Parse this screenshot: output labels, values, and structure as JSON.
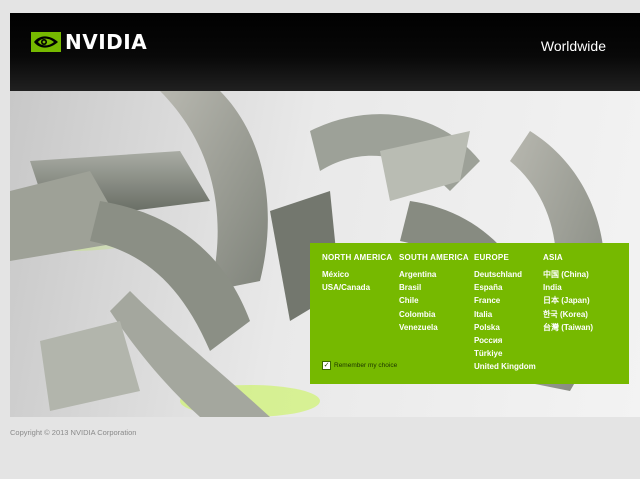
{
  "header": {
    "brand": "NVIDIA",
    "region_title": "Worldwide"
  },
  "regions": [
    {
      "heading": "NORTH AMERICA",
      "links": [
        "México",
        "USA/Canada"
      ]
    },
    {
      "heading": "SOUTH AMERICA",
      "links": [
        "Argentina",
        "Brasil",
        "Chile",
        "Colombia",
        "Venezuela"
      ]
    },
    {
      "heading": "EUROPE",
      "links": [
        "Deutschland",
        "España",
        "France",
        "Italia",
        "Polska",
        "Россия",
        "Türkiye",
        "United Kingdom"
      ]
    },
    {
      "heading": "ASIA",
      "links": [
        "中国 (China)",
        "India",
        "日本 (Japan)",
        "한국 (Korea)",
        "台灣 (Taiwan)"
      ]
    }
  ],
  "remember": {
    "label": "Remember my choice",
    "checked": true
  },
  "footer": {
    "copyright": "Copyright © 2013 NVIDIA Corporation"
  },
  "colors": {
    "accent": "#76b900",
    "header_bg": "#000000",
    "page_bg": "#e4e4e4"
  },
  "icons": {
    "logo": "nvidia-eye-logo-icon",
    "checkbox": "checkmark-icon"
  }
}
